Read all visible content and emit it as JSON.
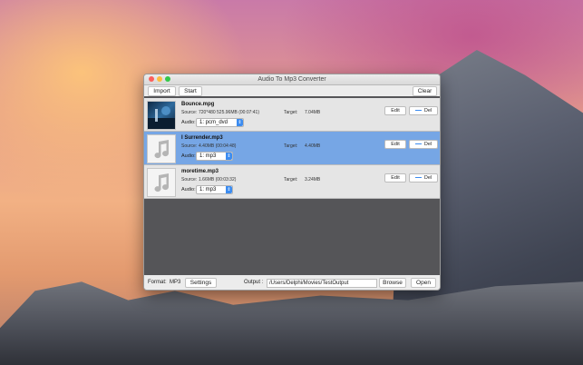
{
  "window": {
    "title": "Audio To Mp3 Converter"
  },
  "toolbar": {
    "import": "Import",
    "start": "Start",
    "clear": "Clear"
  },
  "files": [
    {
      "name": "Bounce.mpg",
      "source_label": "Source:",
      "source_value": "720*480  525.96MB  (00:07:41)",
      "target_label": "Target:",
      "target_value": "7.04MB",
      "audio_label": "Audio:",
      "audio_value": "1: pcm_dvd",
      "edit": "Edit",
      "del": "Del",
      "selected": false,
      "thumb": "video"
    },
    {
      "name": "I Surrender.mp3",
      "source_label": "Source:",
      "source_value": "4.40MB  (00:04:48)",
      "target_label": "Target:",
      "target_value": "4.40MB",
      "audio_label": "Audio:",
      "audio_value": "1: mp3",
      "edit": "Edit",
      "del": "Del",
      "selected": true,
      "thumb": "music-note"
    },
    {
      "name": "moretime.mp3",
      "source_label": "Source:",
      "source_value": "1.66MB  (00:03:32)",
      "target_label": "Target:",
      "target_value": "3.24MB",
      "audio_label": "Audio:",
      "audio_value": "1: mp3",
      "edit": "Edit",
      "del": "Del",
      "selected": false,
      "thumb": "music-note"
    }
  ],
  "bottom": {
    "format_label": "Format:",
    "format_value": "MP3",
    "settings": "Settings",
    "output_label": "Output :",
    "output_path": "/Users/Delphi/Movies/TestOutput",
    "browse": "Browse",
    "open": "Open"
  },
  "colors": {
    "selection": "#76a6e5",
    "accent": "#3c8cf0",
    "list_bg": "#555558"
  }
}
